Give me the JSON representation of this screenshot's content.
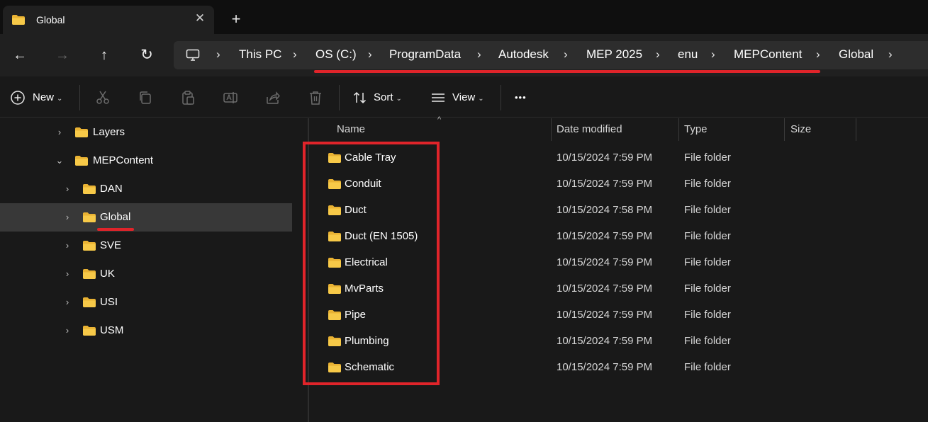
{
  "tab": {
    "title": "Global",
    "close": "✕",
    "new_tab": "+"
  },
  "nav": {
    "back": "←",
    "forward": "→",
    "up": "↑",
    "refresh": "↻"
  },
  "address": {
    "crumbs": [
      "This PC",
      "OS (C:)",
      "ProgramData",
      "Autodesk",
      "MEP 2025",
      "enu",
      "MEPContent",
      "Global"
    ],
    "separator": "›"
  },
  "commands": {
    "new_label": "New",
    "sort_label": "Sort",
    "view_label": "View",
    "more": "•••"
  },
  "sidebar": {
    "items": [
      {
        "label": "Layers",
        "expanded": false
      },
      {
        "label": "MEPContent",
        "expanded": true
      },
      {
        "label": "DAN",
        "expanded": false
      },
      {
        "label": "Global",
        "expanded": false,
        "selected": true
      },
      {
        "label": "SVE",
        "expanded": false
      },
      {
        "label": "UK",
        "expanded": false
      },
      {
        "label": "USI",
        "expanded": false
      },
      {
        "label": "USM",
        "expanded": false
      }
    ]
  },
  "columns": {
    "name": "Name",
    "date": "Date modified",
    "type": "Type",
    "size": "Size"
  },
  "files": [
    {
      "name": "Cable Tray",
      "date": "10/15/2024 7:59 PM",
      "type": "File folder"
    },
    {
      "name": "Conduit",
      "date": "10/15/2024 7:59 PM",
      "type": "File folder"
    },
    {
      "name": "Duct",
      "date": "10/15/2024 7:58 PM",
      "type": "File folder"
    },
    {
      "name": "Duct (EN 1505)",
      "date": "10/15/2024 7:59 PM",
      "type": "File folder"
    },
    {
      "name": "Electrical",
      "date": "10/15/2024 7:59 PM",
      "type": "File folder"
    },
    {
      "name": "MvParts",
      "date": "10/15/2024 7:59 PM",
      "type": "File folder"
    },
    {
      "name": "Pipe",
      "date": "10/15/2024 7:59 PM",
      "type": "File folder"
    },
    {
      "name": "Plumbing",
      "date": "10/15/2024 7:59 PM",
      "type": "File folder"
    },
    {
      "name": "Schematic",
      "date": "10/15/2024 7:59 PM",
      "type": "File folder"
    }
  ],
  "colors": {
    "highlight": "#e0242a",
    "folder": "#f7c948",
    "background": "#191919"
  }
}
